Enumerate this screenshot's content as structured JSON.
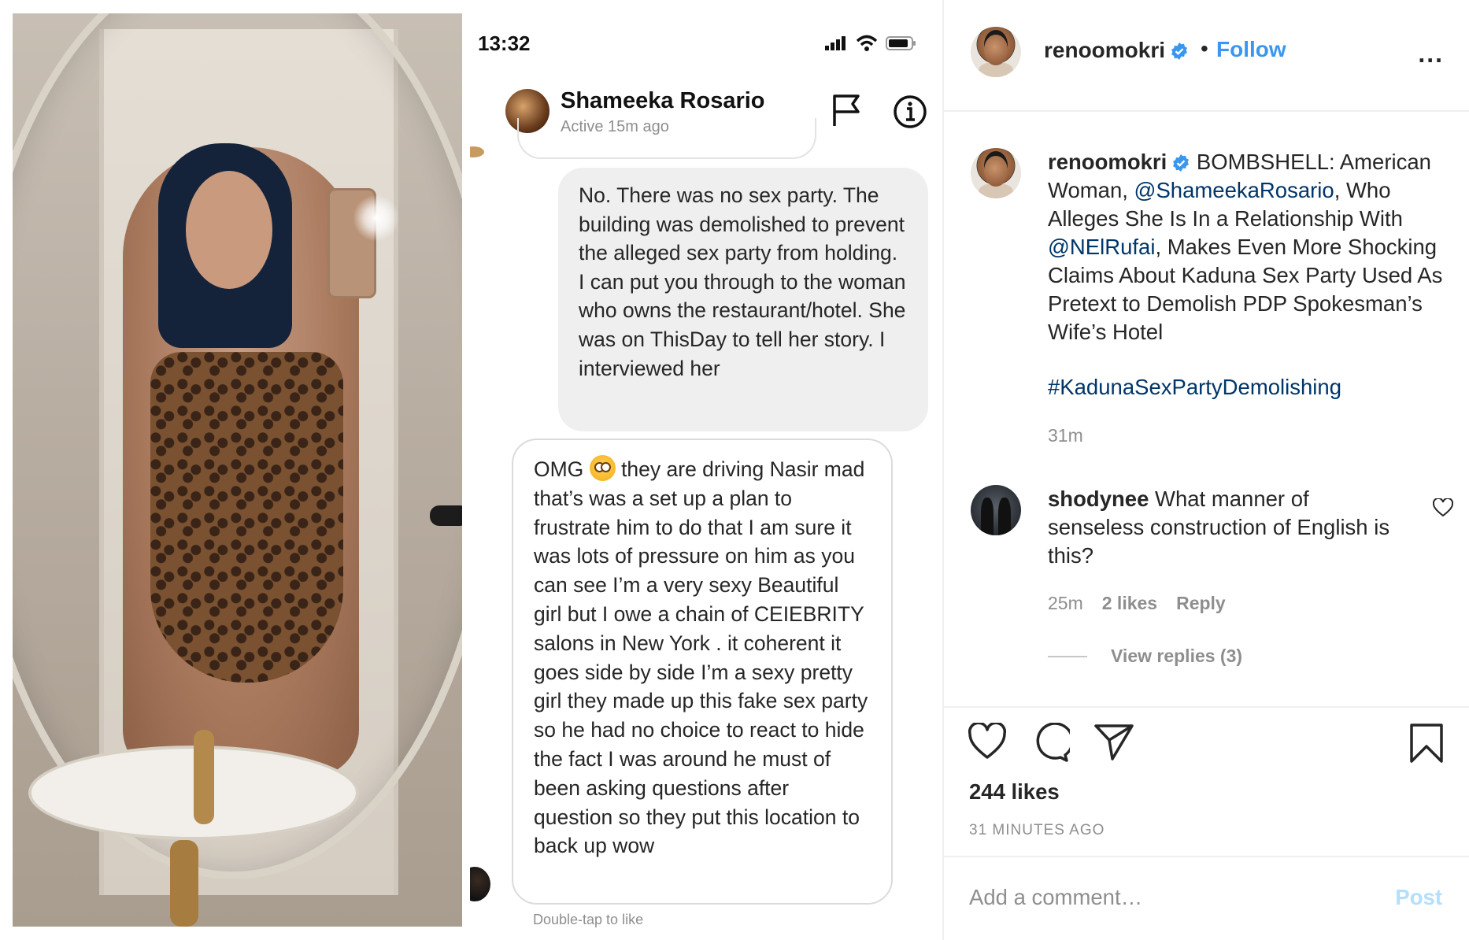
{
  "dm": {
    "status_time": "13:32",
    "contact_name": "Shameeka Rosario",
    "contact_status": "Active 15m ago",
    "sent_message": "No. There was no sex party. The building was demolished to prevent the alleged sex party from holding. I can put you through to the woman who owns the restaurant/hotel. She was on ThisDay to tell her story. I interviewed her",
    "received_message_before_emoji": "OMG",
    "received_message_after_emoji": "they are driving Nasir mad that’s was a set up a plan to frustrate him to do that I am sure it was lots of pressure on him as you can see I’m a very sexy Beautiful girl but I owe a chain of CEIEBRITY salons in New York . it coherent it goes side by side I’m a sexy pretty girl they made up this fake sex party so he had no choice to react to hide the fact I was around he must of been asking questions after question so they put this location to back up wow",
    "double_tap_hint": "Double-tap to like"
  },
  "post": {
    "header": {
      "username": "renoomokri",
      "separator": "•",
      "follow_label": "Follow",
      "more_label": "..."
    },
    "caption": {
      "username": "renoomokri",
      "text_1": " BOMBSHELL: American Woman, ",
      "mention_1": "@ShameekaRosario",
      "text_2": ", Who Alleges She Is In a Relationship With ",
      "mention_2": "@NElRufai",
      "text_3": ", Makes Even More Shocking Claims About Kaduna Sex Party Used As Pretext to Demolish PDP Spokesman’s Wife’s Hotel",
      "hashtag": "#KadunaSexPartyDemolishing",
      "time": "31m"
    },
    "comment": {
      "username": "shodynee",
      "text": " What manner of senseless construction of English is this?",
      "time": "25m",
      "likes": "2 likes",
      "reply_label": "Reply",
      "view_replies": "View replies (3)"
    },
    "likes_count": "244 likes",
    "post_age": "31 MINUTES AGO",
    "add_comment_placeholder": "Add a comment…",
    "post_button": "Post"
  },
  "colors": {
    "link_blue": "#3897f0",
    "mention_navy": "#003569",
    "muted_gray": "#8e8e8e",
    "post_disabled": "#b2dffc",
    "bubble_gray": "#efefef"
  },
  "icons": {
    "dm": [
      "signal-icon",
      "wifi-icon",
      "battery-icon",
      "flag-icon",
      "info-icon",
      "flushed-face-emoji"
    ],
    "post": [
      "verified-badge-icon",
      "more-options-icon",
      "heart-icon",
      "comment-icon",
      "share-icon",
      "bookmark-icon",
      "comment-like-heart-icon"
    ]
  }
}
